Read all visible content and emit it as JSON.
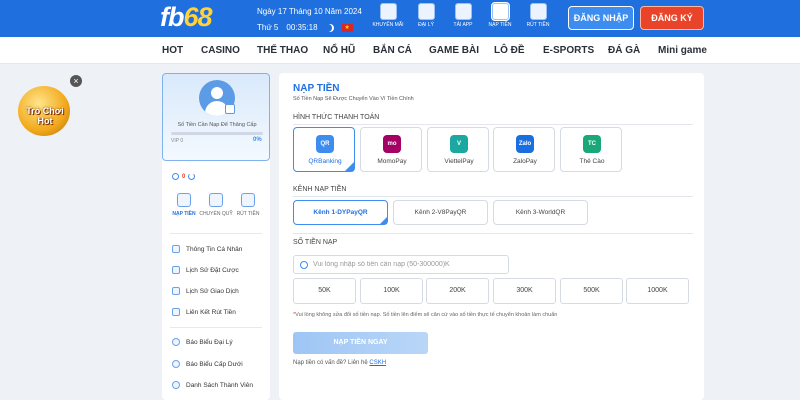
{
  "header": {
    "logo_main": "fb",
    "logo_num": "68",
    "date": "Ngày 17 Tháng 10 Năm 2024",
    "weekday": "Thứ 5",
    "time": "00:35:18",
    "flag_star": "★",
    "quick_links": [
      "KHUYẾN MÃI",
      "ĐẠI LÝ",
      "TẢI APP",
      "NẠP TIỀN",
      "RÚT TIỀN"
    ],
    "login_label": "ĐĂNG NHẬP",
    "register_label": "ĐĂNG KÝ"
  },
  "nav": {
    "items": [
      "HOT",
      "CASINO",
      "THỂ THAO",
      "NỔ HŨ",
      "BẮN CÁ",
      "GAME BÀI",
      "LÔ ĐỀ",
      "E-SPORTS",
      "ĐÁ GÀ",
      "Mini game"
    ]
  },
  "promo": {
    "line1": "Trò Chơi",
    "line2": "Hot",
    "close": "×"
  },
  "sidebar": {
    "upgrade_text": "Số Tiền Cần Nạp Để Thăng Cấp",
    "vip_label": "VIP 0",
    "progress_percent": "0%",
    "progress_fraction": 0,
    "balance": "0",
    "actions": [
      "NẠP TIỀN",
      "CHUYỂN QUỸ",
      "RÚT TIỀN"
    ],
    "menu": [
      "Thông Tin Cá Nhân",
      "Lịch Sử Đặt Cược",
      "Lịch Sử Giao Dịch",
      "Liên Kết Rút Tiền",
      "Báo Biểu Đại Lý",
      "Báo Biểu Cấp Dưới",
      "Danh Sách Thành Viên"
    ]
  },
  "main": {
    "title": "NẠP TIỀN",
    "subtitle": "Số Tiền Nạp Sẽ Được Chuyển Vào Ví Tiền Chính",
    "method_label": "HÌNH THỨC THANH TOÁN",
    "methods": [
      {
        "name": "QRBanking",
        "logo": "QR",
        "color": "#3d8cf0"
      },
      {
        "name": "MomoPay",
        "logo": "mo mo",
        "color": "#a50064"
      },
      {
        "name": "ViettelPay",
        "logo": "V",
        "color": "#1aa8a0"
      },
      {
        "name": "ZaloPay",
        "logo": "Zalo",
        "color": "#1a6fe0"
      },
      {
        "name": "Thẻ Cào",
        "logo": "TC",
        "color": "#1aa87a"
      }
    ],
    "channel_label": "KÊNH NẠP TIỀN",
    "channels": [
      "Kênh 1-DYPayQR",
      "Kênh 2-V8PayQR",
      "Kênh 3-WorldQR"
    ],
    "amount_label": "SỐ TIỀN NẠP",
    "amount_placeholder": "Vui lòng nhập số tiền cần nạp (50-300000)K",
    "presets": [
      "50K",
      "100K",
      "200K",
      "300K",
      "500K",
      "1000K"
    ],
    "note_star": "*",
    "note": "Vui lòng không sửa đổi số tiền nạp. Số tiền lên điểm sẽ căn cứ vào số tiền thực tế chuyển khoản làm chuẩn",
    "submit_label": "NẠP TIỀN NGAY",
    "help_text": "Nạp tiền có vấn đề? Liên hệ",
    "help_link": "CSKH"
  }
}
